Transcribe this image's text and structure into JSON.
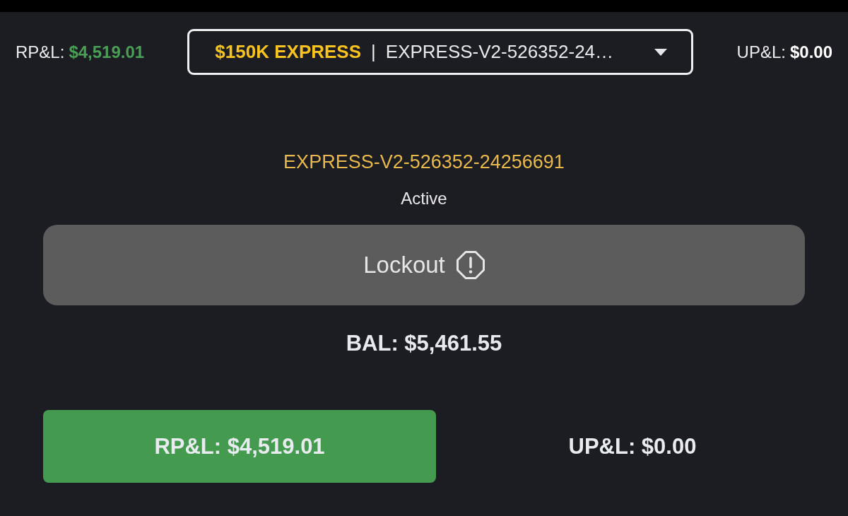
{
  "header": {
    "realized_pnl": {
      "label": "RP&L:",
      "value": "$4,519.01",
      "highlighted": true
    },
    "account_selector": {
      "plan": "$150K EXPRESS",
      "separator": "|",
      "account": "EXPRESS-V2-526352-24…"
    },
    "unrealized_pnl": {
      "label": "UP&L:",
      "value": "$0.00",
      "highlighted": false
    }
  },
  "account": {
    "id": "EXPRESS-V2-526352-24256691",
    "status": "Active"
  },
  "lockout_button": {
    "label": "Lockout"
  },
  "balance": "BAL: $5,461.55",
  "summary": [
    {
      "text": "RP&L: $4,519.01",
      "highlighted": true
    },
    {
      "text": "UP&L: $0.00",
      "highlighted": false
    }
  ]
}
